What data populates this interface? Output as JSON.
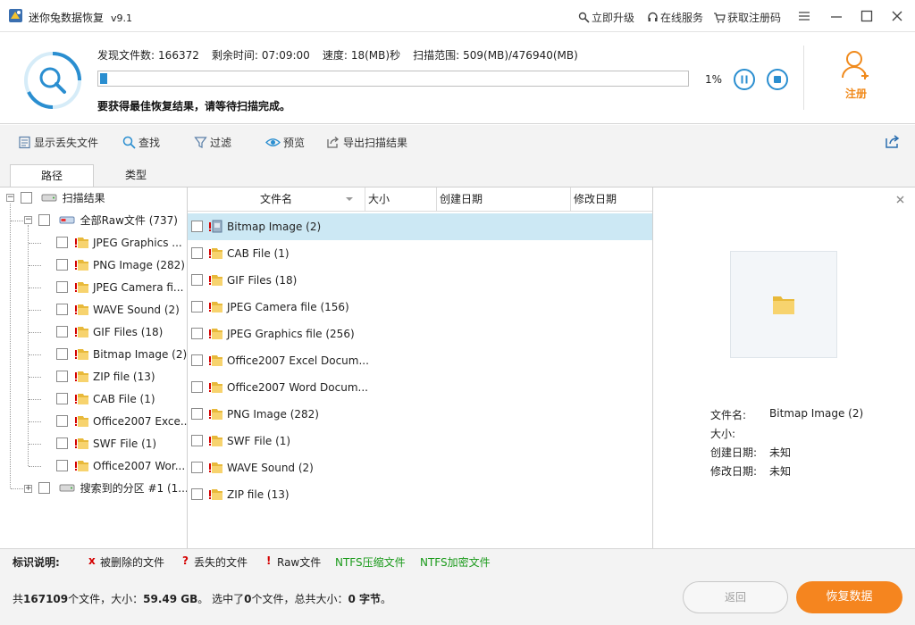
{
  "title": {
    "app_name": "迷你兔数据恢复",
    "version": "v9.1"
  },
  "title_links": {
    "upgrade": "立即升级",
    "online_service": "在线服务",
    "get_code": "获取注册码"
  },
  "scan": {
    "found_label": "发现文件数:",
    "found_value": "166372",
    "remaining_label": "剩余时间:",
    "remaining_value": "07:09:00",
    "speed_label": "速度:",
    "speed_value": "18(MB)秒",
    "range_label": "扫描范围:",
    "range_value": "509(MB)/476940(MB)",
    "percent": "1%",
    "progress_fraction": 0.01,
    "hint": "要获得最佳恢复结果，请等待扫描完成。",
    "register": "注册"
  },
  "toolbar": {
    "show_lost": "显示丢失文件",
    "find": "查找",
    "filter": "过滤",
    "preview": "预览",
    "export": "导出扫描结果"
  },
  "tabs": {
    "path": "路径",
    "type": "类型"
  },
  "tree": {
    "root": "扫描结果",
    "raw_all": "全部Raw文件 (737)",
    "children": [
      "JPEG Graphics ...",
      "PNG Image (282)",
      "JPEG Camera fi...",
      "WAVE Sound (2)",
      "GIF Files (18)",
      "Bitmap Image (2)",
      "ZIP file (13)",
      "CAB File (1)",
      "Office2007 Exce...",
      "SWF File (1)",
      "Office2007 Wor..."
    ],
    "partition": "搜索到的分区 #1 (1..."
  },
  "columns": {
    "name": "文件名",
    "size": "大小",
    "created": "创建日期",
    "modified": "修改日期"
  },
  "files": [
    "Bitmap Image (2)",
    "CAB File (1)",
    "GIF Files (18)",
    "JPEG Camera file (156)",
    "JPEG Graphics file (256)",
    "Office2007 Excel Docum...",
    "Office2007 Word Docum...",
    "PNG Image (282)",
    "SWF File (1)",
    "WAVE Sound (2)",
    "ZIP file (13)"
  ],
  "preview": {
    "name_label": "文件名:",
    "name_value": "Bitmap Image (2)",
    "size_label": "大小:",
    "size_value": "",
    "created_label": "创建日期:",
    "created_value": "未知",
    "modified_label": "修改日期:",
    "modified_value": "未知"
  },
  "legend": {
    "title": "标识说明:",
    "deleted_mark": "x",
    "deleted": "被删除的文件",
    "lost_mark": "?",
    "lost": "丢失的文件",
    "raw_mark": "!",
    "raw": "Raw文件",
    "ntfs_compressed": "NTFS压缩文件",
    "ntfs_encrypted": "NTFS加密文件"
  },
  "summary": {
    "p1": "共",
    "total_files": "167109",
    "p2": "个文件，大小：",
    "total_size": "59.49 GB",
    "p3": "。 选中了",
    "selected_files": "0",
    "p4": "个文件，总共大小：",
    "selected_size": "0 字节",
    "p5": "。"
  },
  "buttons": {
    "back": "返回",
    "recover": "恢复数据"
  },
  "colors": {
    "accent": "#2a8ed0",
    "orange": "#f5851f",
    "selected_row": "#cce8f4",
    "ntfs_green": "#1a9a1a",
    "mark_red": "#d40000"
  }
}
